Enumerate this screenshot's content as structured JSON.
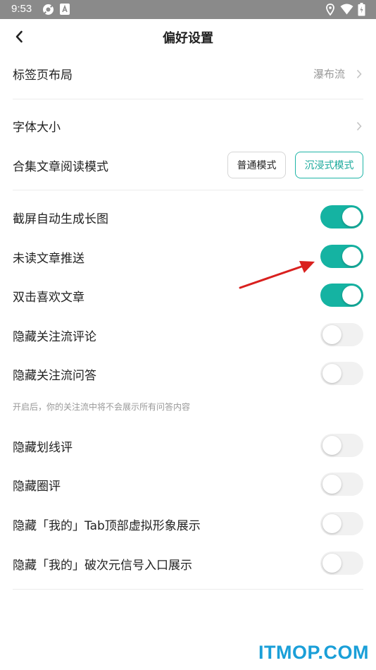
{
  "status_bar": {
    "time": "9:53",
    "icons": [
      "gear-icon",
      "app-a-icon",
      "location-icon",
      "wifi-icon",
      "battery-icon"
    ]
  },
  "header": {
    "title": "偏好设置",
    "back_icon": "chevron-left-icon"
  },
  "section_layout": {
    "tab_layout": {
      "label": "标签页布局",
      "value": "瀑布流"
    }
  },
  "section_reading": {
    "font_size": {
      "label": "字体大小"
    },
    "collection_mode": {
      "label": "合集文章阅读模式",
      "options": [
        "普通模式",
        "沉浸式模式"
      ],
      "selected": "沉浸式模式"
    }
  },
  "section_toggles": {
    "items": [
      {
        "label": "截屏自动生成长图",
        "on": true
      },
      {
        "label": "未读文章推送",
        "on": true
      },
      {
        "label": "双击喜欢文章",
        "on": true
      },
      {
        "label": "隐藏关注流评论",
        "on": false
      },
      {
        "label": "隐藏关注流问答",
        "on": false
      }
    ],
    "hint": "开启后，你的关注流中将不会展示所有问答内容"
  },
  "section_hide": {
    "items": [
      {
        "label": "隐藏划线评",
        "on": false
      },
      {
        "label": "隐藏圈评",
        "on": false
      },
      {
        "label": "隐藏「我的」Tab顶部虚拟形象展示",
        "on": false
      },
      {
        "label": "隐藏「我的」破次元信号入口展示",
        "on": false
      }
    ]
  },
  "colors": {
    "accent": "#15b3a2",
    "annotation_arrow": "#d9201e",
    "watermark": "#1a9fd8"
  },
  "watermark": "ITMOP.COM"
}
